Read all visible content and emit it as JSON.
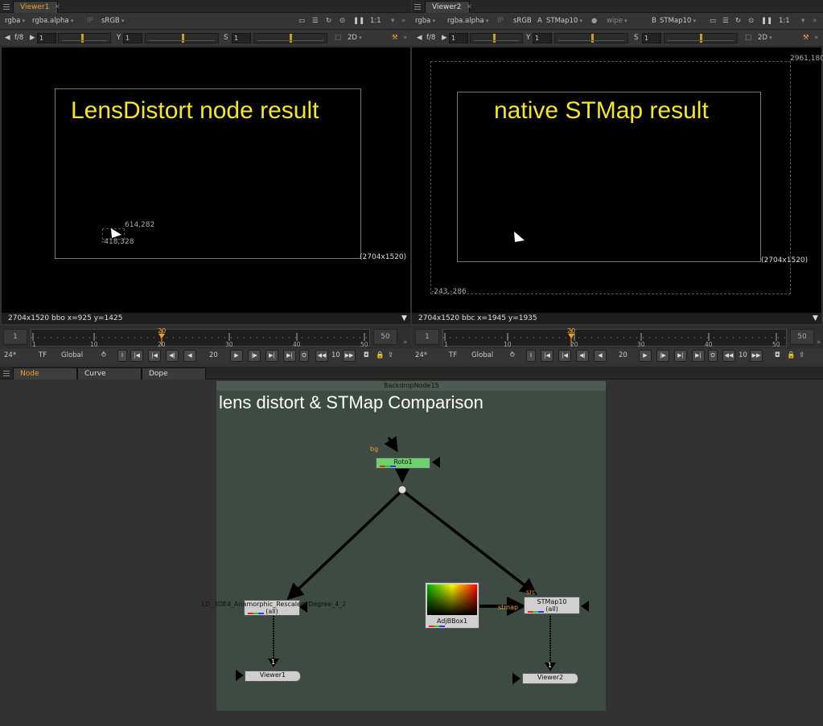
{
  "viewer1": {
    "tab": "Viewer1",
    "channels": "rgba",
    "alpha": "rgba.alpha",
    "ip": "IP",
    "colorspace": "sRGB",
    "zoom": "1:1",
    "fstop": "f/8",
    "gain_val": "1",
    "gain_ticks": [
      "0.01",
      "0.0625",
      "1064"
    ],
    "y_label": "Y",
    "y_val": "1",
    "y_ticks": [
      "0",
      "1",
      "2",
      "4"
    ],
    "s_label": "S",
    "s_val": "1",
    "view_mode": "2D",
    "title": "LensDistort node result",
    "format_label": "(2704x1520)",
    "bbox_top": "614,282",
    "bbox_bottom": "-418,328",
    "status": "2704x1520  bbo  x=925 y=1425"
  },
  "viewer2": {
    "tab": "Viewer2",
    "channels": "rgba",
    "alpha": "rgba.alpha",
    "ip": "IP",
    "colorspace": "sRGB",
    "a_label": "A",
    "a_node": "STMap10",
    "wipe": "wipe",
    "b_label": "B",
    "b_node": "STMap10",
    "zoom": "1:1",
    "fstop": "f/8",
    "gain_val": "1",
    "gain_ticks": [
      "0.01",
      "0.0625",
      "1064"
    ],
    "y_label": "Y",
    "y_val": "1",
    "y_ticks": [
      "0",
      "1",
      "2",
      "4"
    ],
    "s_label": "S",
    "s_val": "1",
    "view_mode": "2D",
    "title": "native STMap result",
    "format_label": "(2704x1520)",
    "bbox_top": "2961,180",
    "bbox_bottom": "-243,-286",
    "status": "2704x1520  bbc  x=1945 y=1935"
  },
  "timeline1": {
    "start": "1",
    "end": "50",
    "current": "20",
    "ticks": [
      "1",
      "10",
      "20",
      "30",
      "40",
      "50"
    ],
    "fps": "24*",
    "tf": "TF",
    "global": "Global",
    "frame": "20",
    "step": "10"
  },
  "timeline2": {
    "start": "1",
    "end": "50",
    "current": "20",
    "ticks": [
      "1",
      "10",
      "20",
      "30",
      "40",
      "50"
    ],
    "fps": "24*",
    "tf": "TF",
    "global": "Global",
    "frame": "20",
    "step": "10"
  },
  "bottom_tabs": [
    "Node Graph",
    "Curve Editor",
    "Dope Sheet"
  ],
  "graph": {
    "backdrop_name": "BackdropNode15",
    "backdrop_title": "lens distort &  STMap Comparison",
    "bg_label": "bg",
    "roto": "Roto1",
    "lens": "LD_3DE4_Anamorphic_Rescaled_Degree_4_2",
    "lens_sub": "(all)",
    "adj": "AdjBBox1",
    "stmap": "STMap10",
    "stmap_sub": "(all)",
    "src_label": "src",
    "stmap_label": "stmap",
    "viewer1": "Viewer1",
    "viewer2": "Viewer2",
    "pipe1": "1",
    "pipe2": "1"
  }
}
